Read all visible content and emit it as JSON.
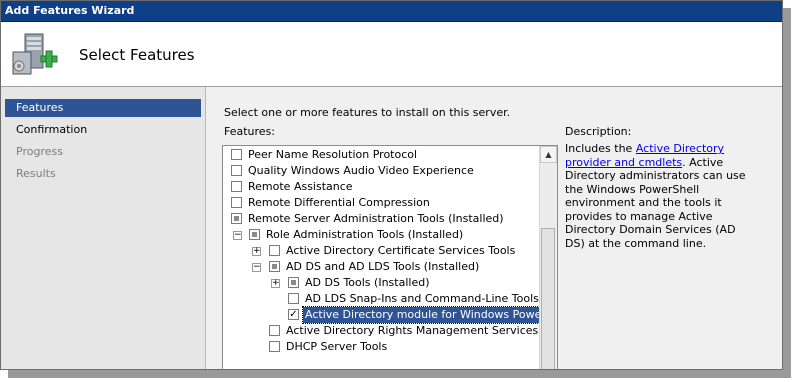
{
  "window": {
    "title": "Add Features Wizard"
  },
  "header": {
    "title": "Select Features",
    "icon": "server-add-icon"
  },
  "sidebar": {
    "items": [
      {
        "label": "Features",
        "state": "active"
      },
      {
        "label": "Confirmation",
        "state": "normal"
      },
      {
        "label": "Progress",
        "state": "disabled"
      },
      {
        "label": "Results",
        "state": "disabled"
      }
    ]
  },
  "main": {
    "instruction": "Select one or more features to install on this server.",
    "features_label": "Features:",
    "description_label": "Description:",
    "description": {
      "prefix": "Includes the ",
      "link": "Active Directory provider and cmdlets",
      "suffix": ". Active Directory administrators can use the Windows PowerShell environment and the tools it provides to manage Active Directory Domain Services (AD DS) at the command line."
    },
    "features": [
      {
        "label": "Peer Name Resolution Protocol",
        "checked": "unchecked",
        "expander": ""
      },
      {
        "label": "Quality Windows Audio Video Experience",
        "checked": "unchecked",
        "expander": ""
      },
      {
        "label": "Remote Assistance",
        "checked": "unchecked",
        "expander": ""
      },
      {
        "label": "Remote Differential Compression",
        "checked": "unchecked",
        "expander": ""
      },
      {
        "label": "Remote Server Administration Tools  (Installed)",
        "checked": "partial",
        "expander": ""
      },
      {
        "label": "Role Administration Tools  (Installed)",
        "checked": "partial",
        "expander": "−"
      },
      {
        "label": "Active Directory Certificate Services Tools",
        "checked": "unchecked",
        "expander": "+"
      },
      {
        "label": "AD DS and AD LDS Tools  (Installed)",
        "checked": "partial",
        "expander": "−"
      },
      {
        "label": "AD DS Tools  (Installed)",
        "checked": "partial",
        "expander": "+"
      },
      {
        "label": "AD LDS Snap-Ins and Command-Line Tools",
        "checked": "unchecked",
        "expander": ""
      },
      {
        "label": "Active Directory module for Windows PowerShell",
        "checked": "checked",
        "expander": ""
      },
      {
        "label": "Active Directory Rights Management Services Tools",
        "checked": "unchecked",
        "expander": ""
      },
      {
        "label": "DHCP Server Tools",
        "checked": "unchecked",
        "expander": ""
      }
    ]
  },
  "colors": {
    "titlebar": "#0f3f86",
    "selection": "#2f5496",
    "link": "#0000ee"
  }
}
